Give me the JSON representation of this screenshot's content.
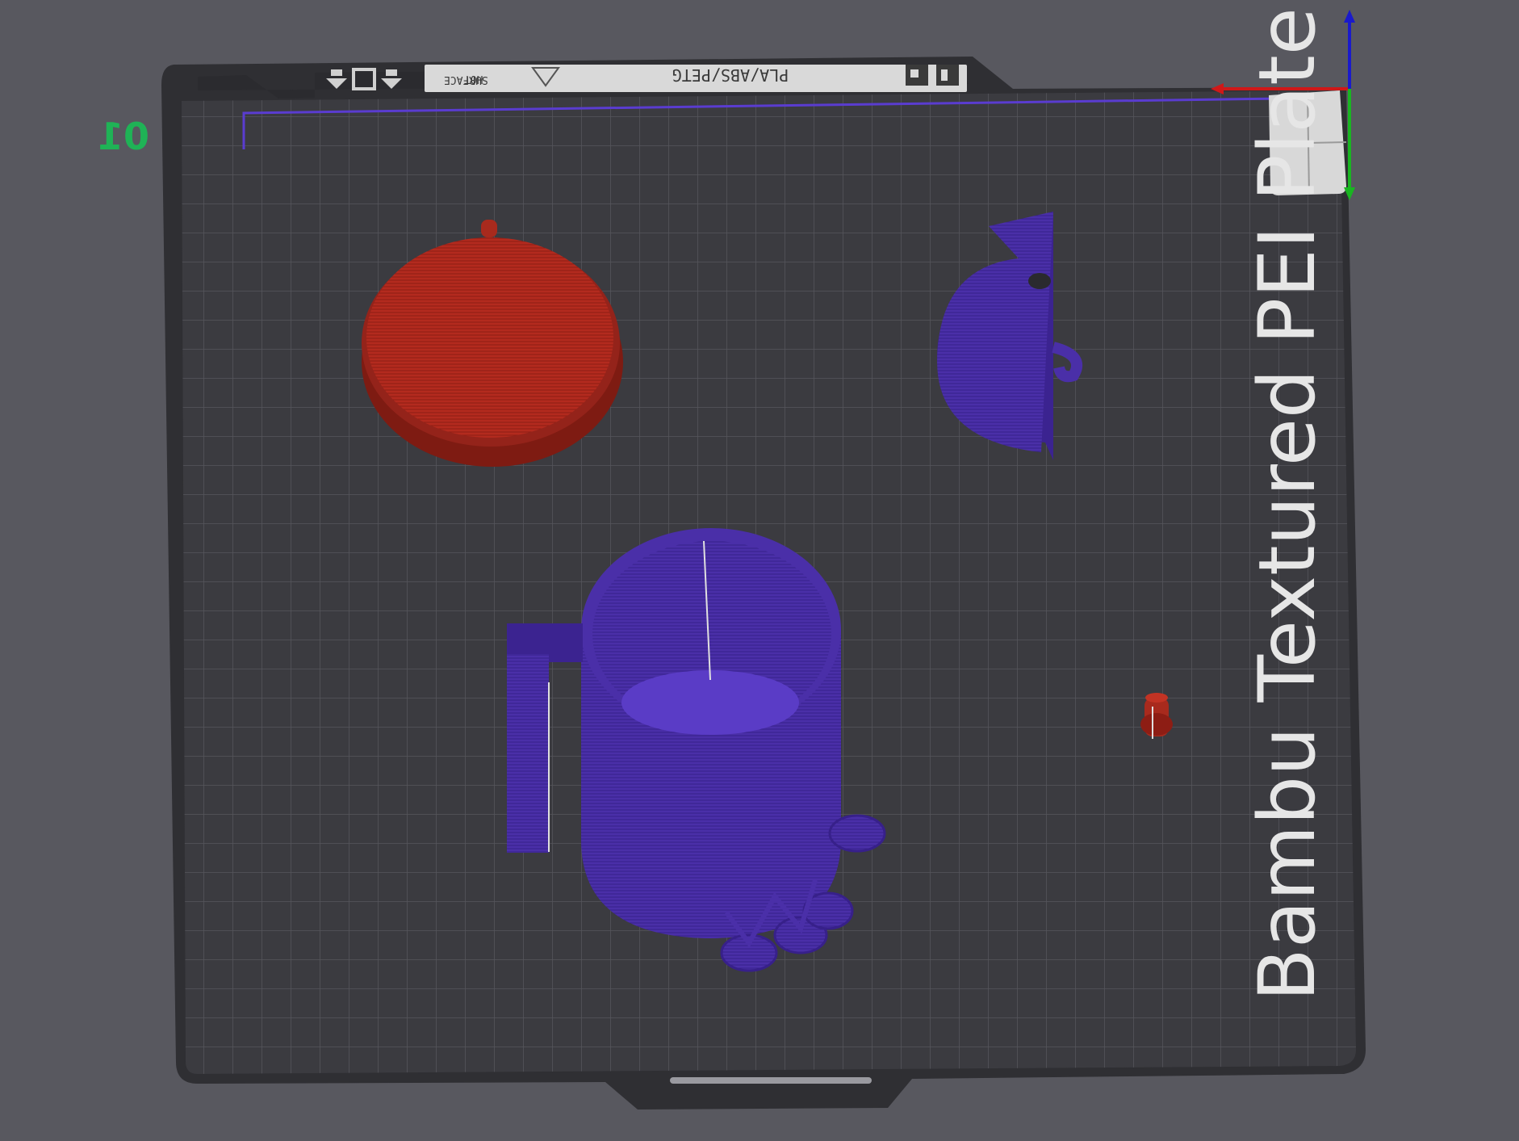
{
  "viewport": {
    "background_color": "#58585f",
    "plate_color": "#3b3b40",
    "grid_color": "#55555b"
  },
  "plate": {
    "number": "01",
    "label": "Bambu Textured PEI Plate",
    "strip": {
      "filament_text": "PLA/ABS/PETG",
      "warning_text_line1": "HOT",
      "warning_text_line2": "SURFACE",
      "icons": [
        "arrow-down-icon",
        "square-icon",
        "arrow-down-icon",
        "warning-triangle-icon",
        "qr-marker-icon",
        "qr-marker-icon"
      ]
    }
  },
  "axes": {
    "x_color": "#d01818",
    "y_color": "#19b521",
    "z_color": "#1a1acc"
  },
  "objects": [
    {
      "name": "round-lid",
      "color": "#b32a1e"
    },
    {
      "name": "half-disc-part",
      "color": "#4a2fa8"
    },
    {
      "name": "mug-body",
      "color": "#4a2fa8"
    },
    {
      "name": "small-peg",
      "color": "#b32a1e"
    }
  ]
}
